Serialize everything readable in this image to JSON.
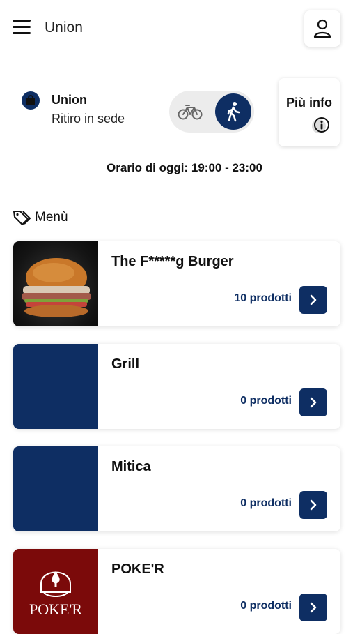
{
  "header": {
    "title": "Union",
    "menu_icon": "hamburger-icon",
    "profile_icon": "user-icon"
  },
  "store": {
    "name": "Union",
    "mode": "Ritiro in sede",
    "icon": "shopping-bag-icon",
    "delivery_options": [
      "bike-icon",
      "walk-icon"
    ],
    "selected_option": "walk-icon",
    "info_label": "Più info",
    "info_icon": "info-icon"
  },
  "hours": "Orario di oggi: 19:00 - 23:00",
  "menu_section": {
    "label": "Menù",
    "icon": "tag-icon"
  },
  "categories": [
    {
      "name": "The F*****g Burger",
      "count": "10 prodotti",
      "thumb": "burger-photo"
    },
    {
      "name": "Grill",
      "count": "0 prodotti",
      "thumb": "blue-placeholder"
    },
    {
      "name": "Mitica",
      "count": "0 prodotti",
      "thumb": "blue-placeholder"
    },
    {
      "name": "POKE'R",
      "count": "0 prodotti",
      "thumb": "poker-logo",
      "logo_text": "POKE'R"
    }
  ],
  "colors": {
    "primary": "#0e2e63",
    "poker_red": "#7b0a0a",
    "toggle_bg": "#ececec"
  }
}
